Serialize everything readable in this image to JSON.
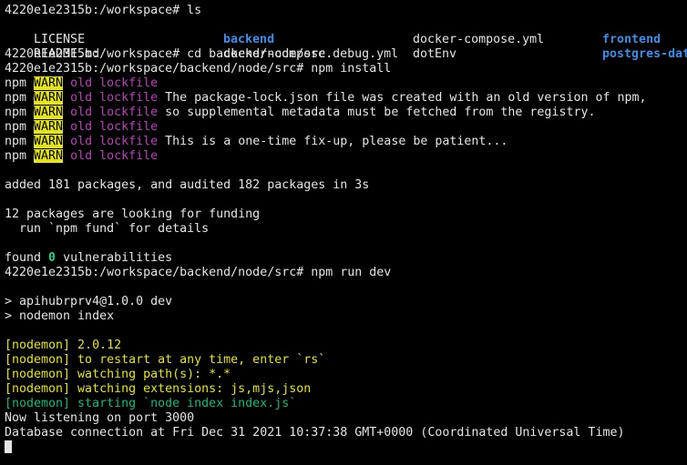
{
  "terminal": {
    "colors": {
      "background": "#000000",
      "foreground": "#e5e5e5",
      "directory": "#3b8eea",
      "warn_badge": "#e5e510",
      "lockfile": "#bc3fbc",
      "zero_count": "#23d18b",
      "nodemon_yellow": "#e5e510",
      "nodemon_green": "#0dbc79"
    },
    "prompt1": "4220e1e2315b:/workspace# ls",
    "ls": {
      "row1": [
        "LICENSE",
        "backend",
        "docker-compose.yml",
        "frontend"
      ],
      "row2": [
        "README.md",
        "docker-compose.debug.yml",
        "dotEnv",
        "postgres-data"
      ]
    },
    "prompt2": "4220e1e2315b:/workspace# cd backend/node/src",
    "prompt3": "4220e1e2315b:/workspace/backend/node/src# npm install",
    "warn": {
      "prefix": "npm ",
      "badge": "WARN",
      "lockfile": " old lockfile",
      "messages": [
        "",
        " The package-lock.json file was created with an old version of npm,",
        " so supplemental metadata must be fetched from the registry.",
        "",
        " This is a one-time fix-up, please be patient...",
        ""
      ]
    },
    "added": "added 181 packages, and audited 182 packages in 3s",
    "funding1": "12 packages are looking for funding",
    "funding2": "  run `npm fund` for details",
    "found": {
      "prefix": "found ",
      "count": "0",
      "suffix": " vulnerabilities"
    },
    "prompt4": "4220e1e2315b:/workspace/backend/node/src# npm run dev",
    "script1": "> apihubrprv4@1.0.0 dev",
    "script2": "> nodemon index",
    "nodemon": [
      "[nodemon] 2.0.12",
      "[nodemon] to restart at any time, enter `rs`",
      "[nodemon] watching path(s): *.*",
      "[nodemon] watching extensions: js,mjs,json"
    ],
    "nodemon_start": "[nodemon] starting `node index index.js`",
    "listening": "Now listening on port 3000",
    "db": "Database connection at Fri Dec 31 2021 10:37:38 GMT+0000 (Coordinated Universal Time)"
  }
}
